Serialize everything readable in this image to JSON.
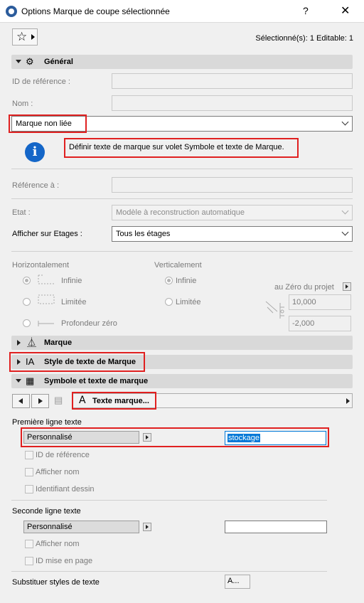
{
  "window": {
    "title": "Options Marque de coupe sélectionnée",
    "help": "?",
    "close": "✕"
  },
  "toolbar": {
    "selection_info": "Sélectionné(s): 1 Editable: 1"
  },
  "general": {
    "title": "Général",
    "id_label": "ID de référence :",
    "name_label": "Nom :",
    "marker_type": "Marque non liée",
    "info_text": "Définir texte de marque sur volet Symbole et texte de Marque.",
    "reference_label": "Référence à :",
    "state_label": "Etat :",
    "state_value": "Modèle à reconstruction automatique",
    "show_on_stories_label": "Afficher sur Etages :",
    "show_on_stories_value": "Tous les étages",
    "horizontal_label": "Horizontalement",
    "vertical_label": "Verticalement",
    "h_options": [
      "Infinie",
      "Limitée",
      "Profondeur zéro"
    ],
    "v_options": [
      "Infinie",
      "Limitée"
    ],
    "project_zero_label": "au Zéro du projet",
    "top_value": "10,000",
    "bottom_value": "-2,000"
  },
  "sections": {
    "marker": "Marque",
    "text_style": "Style de texte de Marque",
    "symbol_text": "Symbole et texte de marque"
  },
  "symbol_panel": {
    "page_button": "Texte marque...",
    "first_line_label": "Première ligne texte",
    "first_line_mode": "Personnalisé",
    "first_line_value": "stockage",
    "first_checks": [
      "ID de référence",
      "Afficher nom",
      "Identifiant dessin"
    ],
    "second_line_label": "Seconde ligne texte",
    "second_line_mode": "Personnalisé",
    "second_line_value": "",
    "second_checks": [
      "Afficher nom",
      "ID mise en page"
    ],
    "override_label": "Substituer styles de texte",
    "override_button": "A..."
  },
  "colors": {
    "highlight_red": "#e02020",
    "info_blue": "#1466c8",
    "section_grey": "#d9d9d9"
  }
}
